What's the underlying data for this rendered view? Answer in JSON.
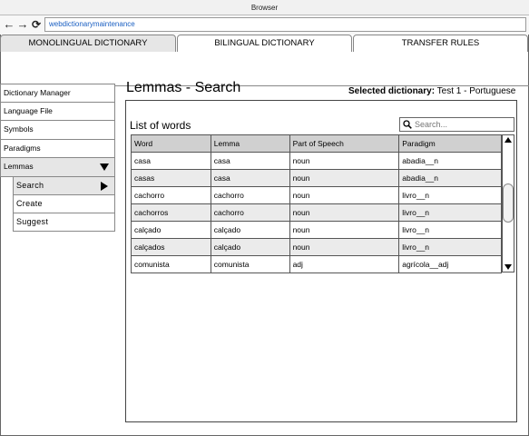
{
  "browser": {
    "title": "Browser",
    "url": "webdictionarymaintenance",
    "back_icon": "arrow-left",
    "forward_icon": "arrow-right",
    "reload_icon": "reload"
  },
  "tabs": [
    {
      "label": "MONOLINGUAL DICTIONARY",
      "active": true
    },
    {
      "label": "BILINGUAL DICTIONARY",
      "active": false
    },
    {
      "label": "TRANSFER RULES",
      "active": false
    }
  ],
  "sidebar": {
    "items": [
      {
        "label": "Dictionary Manager"
      },
      {
        "label": "Language File"
      },
      {
        "label": "Symbols"
      },
      {
        "label": "Paradigms"
      },
      {
        "label": "Lemmas",
        "expanded": true
      }
    ],
    "subitems": [
      {
        "label": "Search",
        "active": true
      },
      {
        "label": "Create"
      },
      {
        "label": "Suggest"
      }
    ]
  },
  "page": {
    "title": "Lemmas - Search",
    "selected_label": "Selected dictionary:",
    "selected_value": " Test 1 - Portuguese"
  },
  "list": {
    "title": "List of words",
    "search_placeholder": "Search...",
    "columns": [
      "Word",
      "Lemma",
      "Part of Speech",
      "Paradigm"
    ],
    "rows": [
      [
        "casa",
        "casa",
        "noun",
        "abadia__n"
      ],
      [
        "casas",
        "casa",
        "noun",
        "abadia__n"
      ],
      [
        "cachorro",
        "cachorro",
        "noun",
        "livro__n"
      ],
      [
        "cachorros",
        "cachorro",
        "noun",
        "livro__n"
      ],
      [
        "calçado",
        "calçado",
        "noun",
        "livro__n"
      ],
      [
        "calçados",
        "calçado",
        "noun",
        "livro__n"
      ],
      [
        "comunista",
        "comunista",
        "adj",
        "agrícola__adj"
      ]
    ]
  },
  "colors": {
    "active_bg": "#e6e6e6",
    "header_bg": "#d0d0d0",
    "alt_row_bg": "#ebebeb",
    "url_color": "#1a5fc2"
  }
}
